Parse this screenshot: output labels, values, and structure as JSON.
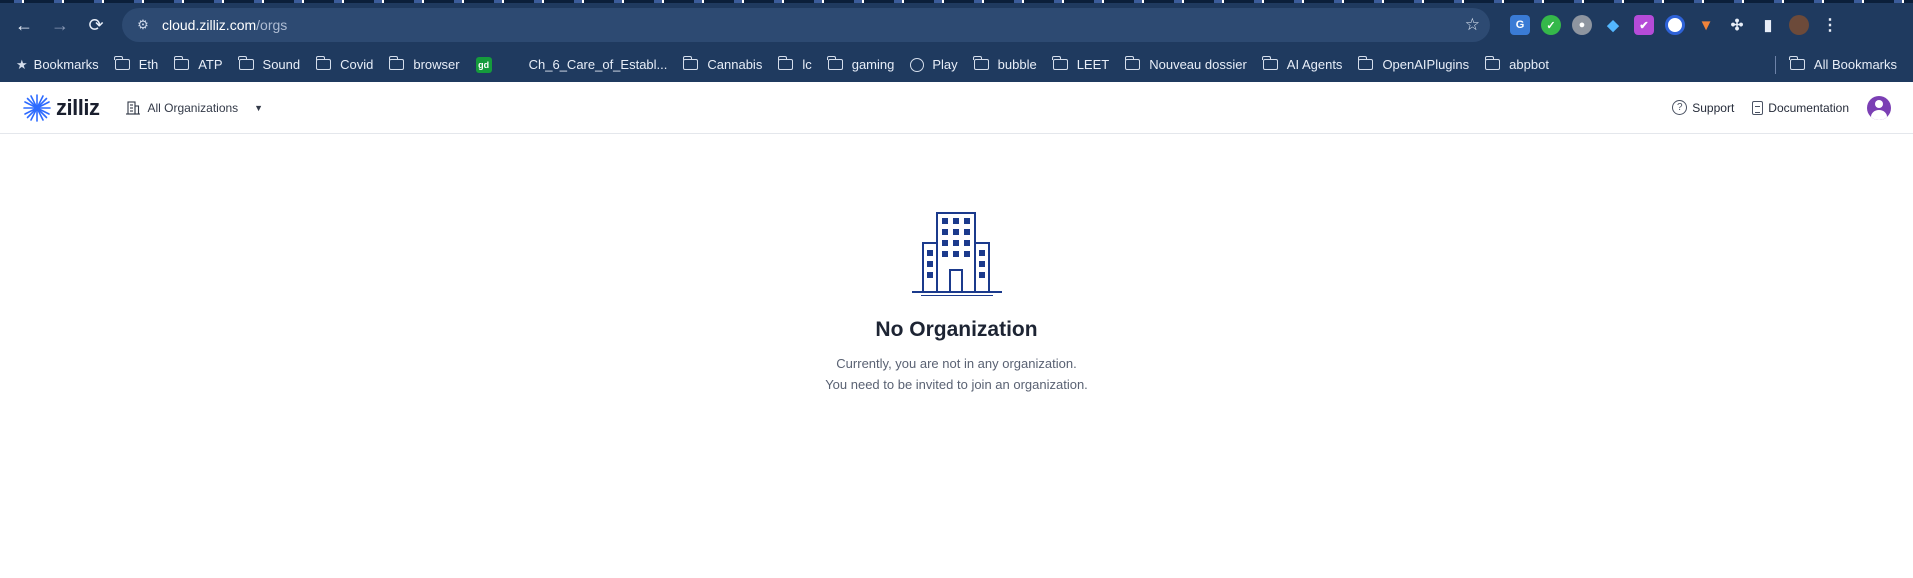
{
  "browser": {
    "url_host": "cloud.zilliz.com",
    "url_path": "/orgs",
    "bookmarks": [
      {
        "label": "Bookmarks",
        "icon": "star-icon"
      },
      {
        "label": "Eth",
        "icon": "folder-icon"
      },
      {
        "label": "ATP",
        "icon": "folder-icon"
      },
      {
        "label": "Sound",
        "icon": "folder-icon"
      },
      {
        "label": "Covid",
        "icon": "folder-icon"
      },
      {
        "label": "browser",
        "icon": "folder-icon"
      },
      {
        "label": "gd",
        "icon": "gd-favicon"
      },
      {
        "label": "Ch_6_Care_of_Establ...",
        "icon": "none"
      },
      {
        "label": "Cannabis",
        "icon": "folder-icon"
      },
      {
        "label": "lc",
        "icon": "folder-icon"
      },
      {
        "label": "gaming",
        "icon": "folder-icon"
      },
      {
        "label": "Play",
        "icon": "globe-icon"
      },
      {
        "label": "bubble",
        "icon": "folder-icon"
      },
      {
        "label": "LEET",
        "icon": "folder-icon"
      },
      {
        "label": "Nouveau dossier",
        "icon": "folder-icon"
      },
      {
        "label": "AI Agents",
        "icon": "folder-icon"
      },
      {
        "label": "OpenAIPlugins",
        "icon": "folder-icon"
      },
      {
        "label": "abpbot",
        "icon": "folder-icon"
      }
    ],
    "all_bookmarks_label": "All Bookmarks"
  },
  "header": {
    "logo_text": "zilliz",
    "org_switch_label": "All Organizations",
    "support_label": "Support",
    "documentation_label": "Documentation"
  },
  "empty_state": {
    "title": "No Organization",
    "line1": "Currently, you are not in any organization.",
    "line2": "You need to be invited to join an organization."
  },
  "colors": {
    "chrome_bg": "#1f3a5f",
    "illustration": "#1b3a8c",
    "logo_star": "#2d6bff"
  }
}
